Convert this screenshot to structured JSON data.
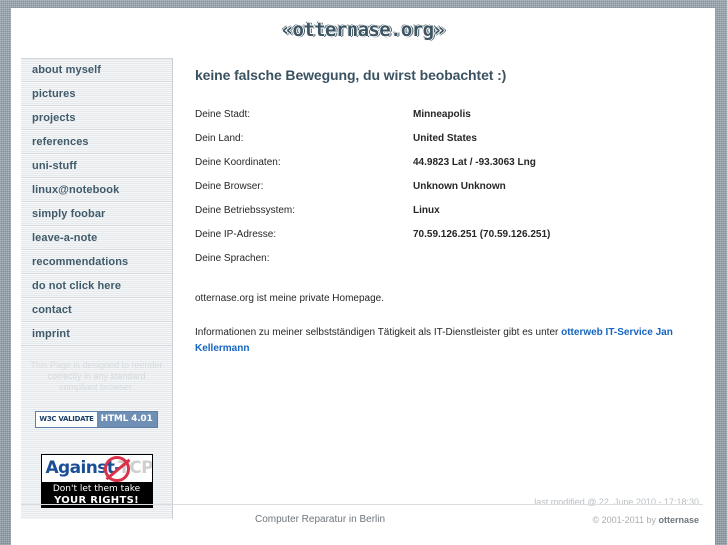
{
  "site": {
    "logo_text": "«otternase.org»"
  },
  "sidebar": {
    "items": [
      {
        "label": "about myself"
      },
      {
        "label": "pictures"
      },
      {
        "label": "projects"
      },
      {
        "label": "references"
      },
      {
        "label": "uni-stuff"
      },
      {
        "label": "linux@notebook"
      },
      {
        "label": "simply foobar"
      },
      {
        "label": "leave-a-note"
      },
      {
        "label": "recommendations"
      },
      {
        "label": "do not click here"
      },
      {
        "label": "contact"
      },
      {
        "label": "imprint"
      }
    ],
    "browser_note": "This Page is designed to reender correctly in any standard compliant browser.",
    "w3c_badge": {
      "left_text": "W3C VALIDATE",
      "right_text": "HTML 4.01"
    },
    "tcpa_badge": {
      "title_prefix": "Against-",
      "title_word": "TCPA",
      "line1": "Don't let them take",
      "line2": "YOUR RIGHTS!"
    }
  },
  "main": {
    "title": "keine falsche Bewegung, du wirst beobachtet :)",
    "info_rows": [
      {
        "label": "Deine Stadt:",
        "value": "Minneapolis"
      },
      {
        "label": "Dein Land:",
        "value": "United States"
      },
      {
        "label": "Deine Koordinaten:",
        "value": "44.9823 Lat / -93.3063 Lng"
      },
      {
        "label": "Deine Browser:",
        "value": "Unknown Unknown"
      },
      {
        "label": "Deine Betriebssystem:",
        "value": "Linux"
      },
      {
        "label": "Deine IP-Adresse:",
        "value": "70.59.126.251 (70.59.126.251)"
      },
      {
        "label": "Deine Sprachen:",
        "value": ""
      }
    ],
    "paragraph_1": "otternase.org ist meine private Homepage.",
    "paragraph_2_text": "Informationen zu meiner selbstständigen Tätigkeit als IT-Dienstleister gibt es unter ",
    "paragraph_2_link": "otterweb IT-Service Jan Kellermann",
    "last_modified": "last modified @ 22. June 2010 - 17:18:30"
  },
  "footer": {
    "left_text": "Computer Reparatur in Berlin",
    "copyright_prefix": "© 2001-2011 by ",
    "copyright_owner": "otternase"
  },
  "colors": {
    "accent": "#3d5562",
    "link": "#1565c0",
    "sidebar_bg": "#e9ecee",
    "page_bg": "#8d9aa4"
  }
}
